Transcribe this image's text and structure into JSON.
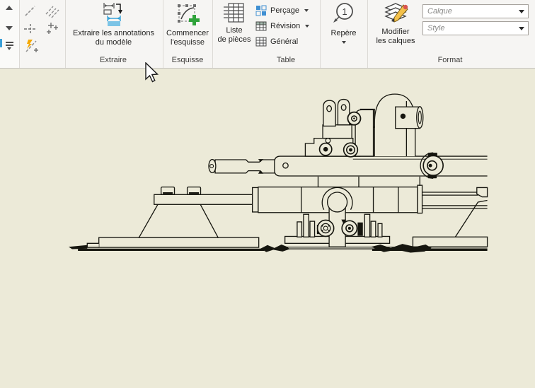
{
  "ribbon": {
    "groups": {
      "extraire": {
        "label": "Extraire",
        "annotate_line1": "Extraire les annotations",
        "annotate_line2": "du modèle"
      },
      "esquisse": {
        "label": "Esquisse",
        "start_sketch_line1": "Commencer",
        "start_sketch_line2": "l'esquisse"
      },
      "table": {
        "label": "Table",
        "parts_list_line1": "Liste",
        "parts_list_line2": "de pièces",
        "hole": "Perçage",
        "revision": "Révision",
        "general": "Général"
      },
      "repere": {
        "label": "Repère",
        "badge": "1"
      },
      "format": {
        "label": "Format",
        "modify_layers_line1": "Modifier",
        "modify_layers_line2": "les calques",
        "layer_placeholder": "Calque",
        "style_placeholder": "Style"
      }
    }
  },
  "colors": {
    "canvas_bg": "#ECEAD8",
    "ribbon_bg": "#F6F5F3",
    "accent_blue": "#2D9FD8",
    "accent_green": "#2FA33A",
    "accent_orange": "#F5A800",
    "drawing_line": "#16160F"
  }
}
